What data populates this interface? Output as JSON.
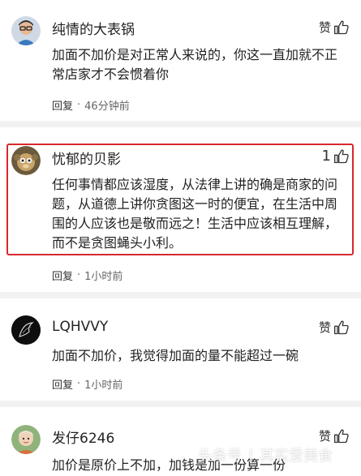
{
  "comments": [
    {
      "name": "纯情的大表锅",
      "like_label": "赞",
      "like_count": "",
      "text": "加面不加价是对正常人来说的，你这一直加就不正常店家才不会惯着你",
      "reply": "回复",
      "time": "46分钟前"
    },
    {
      "name": "忧郁的贝影",
      "like_label": "",
      "like_count": "1",
      "text": "任何事情都应该湿度，从法律上讲的确是商家的问题，从道德上讲你贪图这一时的便宜，在生活中周围的人应该也是敬而远之！生活中应该相互理解，而不是贪图蝇头小利。",
      "reply": "回复",
      "time": "1小时前"
    },
    {
      "name": "LQHVVY",
      "like_label": "赞",
      "like_count": "",
      "text": "加面不加价，我觉得加面的量不能超过一碗",
      "reply": "回复",
      "time": "1小时前"
    },
    {
      "name": "发仔6246",
      "like_label": "赞",
      "like_count": "",
      "text": "加价是原价上不加，加钱是加一份算一份",
      "reply": "",
      "time": ""
    }
  ],
  "watermark": {
    "prefix": "头条号",
    "author": "其实爱美食"
  },
  "colors": {
    "highlight_border": "#d8282d",
    "divider": "#f2f2f2"
  }
}
